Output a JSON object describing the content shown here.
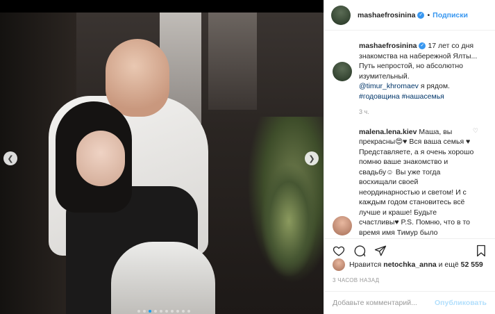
{
  "post": {
    "author": "mashaefrosinina",
    "follow_label": "Подписки",
    "separator": "•",
    "caption_text": "17 лет со дня знакомства на набережной Ялты... Путь непростой, но абсолютно изумительный.",
    "mention": "@timur_khromaev",
    "after_mention": " я рядом.",
    "hashtags": "#годовщина #нашасемья",
    "caption_time": "3 ч.",
    "carousel": {
      "dot_count": 10,
      "active_index": 2
    }
  },
  "comments": [
    {
      "user": "malena.lena.kiev",
      "text": "Маша, вы прекрасны😍♥ Вся ваша семья ♥ Представляете, а я очень хорошо помню ваше знакомство и свадьбу☺ Вы уже тогда восхищали своей неординарностью и светом! И с каждым годом становитесь всё лучше и краше! Будьте счастливы♥ P.S. Помню, что в то время имя Тимур было"
    }
  ],
  "likes": {
    "prefix": "Нравится ",
    "user": "netochka_anna",
    "middle": " и ещё ",
    "count": "52 559"
  },
  "posted_ago": "3 часов назад",
  "comment_input": {
    "placeholder": "Добавьте комментарий...",
    "value": ""
  },
  "publish_label": "Опубликовать",
  "icons": {
    "like": "heart-icon",
    "comment": "comment-icon",
    "share": "share-icon",
    "save": "bookmark-icon",
    "verified": "verified-badge-icon"
  },
  "colors": {
    "link": "#3897f0",
    "hashtag": "#003569",
    "muted": "#999999",
    "publish_disabled": "#b2dffc"
  }
}
